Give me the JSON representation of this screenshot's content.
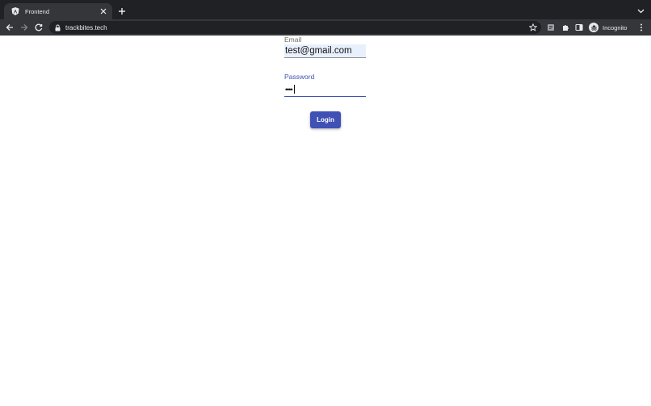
{
  "browser": {
    "tab": {
      "title": "Frontend",
      "favicon_letter": "A"
    },
    "address": {
      "url": "trackbites.tech"
    },
    "profile": {
      "label": "Incognito"
    }
  },
  "login_form": {
    "email": {
      "label": "Email",
      "value": "test@gmail.com"
    },
    "password": {
      "label": "Password",
      "masked_value": "••••"
    },
    "submit_label": "Login"
  },
  "colors": {
    "primary": "#3f51b5",
    "autofill_bg": "#e8f0fe",
    "chrome_dark": "#202124",
    "chrome_toolbar": "#35363a"
  }
}
